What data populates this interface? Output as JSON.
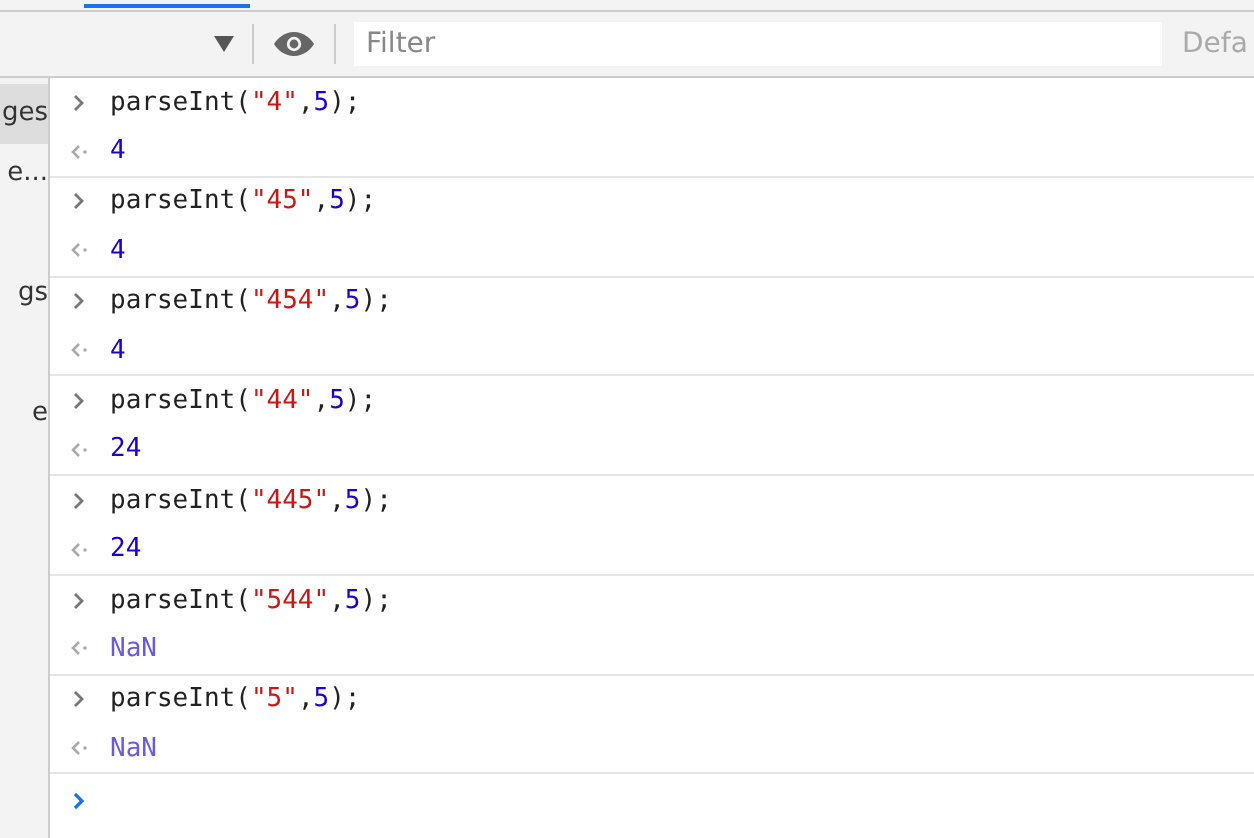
{
  "toolbar": {
    "filter": {
      "placeholder": "Filter"
    },
    "levels_label": "Defa"
  },
  "sidebar": {
    "items": [
      {
        "label": "ges",
        "selected": true
      },
      {
        "label": "e...",
        "selected": false
      },
      {
        "label": "gs",
        "selected": false
      },
      {
        "label": "e",
        "selected": false
      }
    ]
  },
  "console": {
    "entries": [
      {
        "input": [
          {
            "kind": "plain",
            "text": "parseInt("
          },
          {
            "kind": "string",
            "text": "\"4\""
          },
          {
            "kind": "plain",
            "text": ","
          },
          {
            "kind": "number",
            "text": "5"
          },
          {
            "kind": "plain",
            "text": ");"
          }
        ],
        "result": {
          "kind": "number",
          "text": "4"
        }
      },
      {
        "input": [
          {
            "kind": "plain",
            "text": "parseInt("
          },
          {
            "kind": "string",
            "text": "\"45\""
          },
          {
            "kind": "plain",
            "text": ","
          },
          {
            "kind": "number",
            "text": "5"
          },
          {
            "kind": "plain",
            "text": ");"
          }
        ],
        "result": {
          "kind": "number",
          "text": "4"
        }
      },
      {
        "input": [
          {
            "kind": "plain",
            "text": "parseInt("
          },
          {
            "kind": "string",
            "text": "\"454\""
          },
          {
            "kind": "plain",
            "text": ","
          },
          {
            "kind": "number",
            "text": "5"
          },
          {
            "kind": "plain",
            "text": ");"
          }
        ],
        "result": {
          "kind": "number",
          "text": "4"
        }
      },
      {
        "input": [
          {
            "kind": "plain",
            "text": "parseInt("
          },
          {
            "kind": "string",
            "text": "\"44\""
          },
          {
            "kind": "plain",
            "text": ","
          },
          {
            "kind": "number",
            "text": "5"
          },
          {
            "kind": "plain",
            "text": ");"
          }
        ],
        "result": {
          "kind": "number",
          "text": "24"
        }
      },
      {
        "input": [
          {
            "kind": "plain",
            "text": "parseInt("
          },
          {
            "kind": "string",
            "text": "\"445\""
          },
          {
            "kind": "plain",
            "text": ","
          },
          {
            "kind": "number",
            "text": "5"
          },
          {
            "kind": "plain",
            "text": ");"
          }
        ],
        "result": {
          "kind": "number",
          "text": "24"
        }
      },
      {
        "input": [
          {
            "kind": "plain",
            "text": "parseInt("
          },
          {
            "kind": "string",
            "text": "\"544\""
          },
          {
            "kind": "plain",
            "text": ","
          },
          {
            "kind": "number",
            "text": "5"
          },
          {
            "kind": "plain",
            "text": ");"
          }
        ],
        "result": {
          "kind": "nan",
          "text": "NaN"
        }
      },
      {
        "input": [
          {
            "kind": "plain",
            "text": "parseInt("
          },
          {
            "kind": "string",
            "text": "\"5\""
          },
          {
            "kind": "plain",
            "text": ","
          },
          {
            "kind": "number",
            "text": "5"
          },
          {
            "kind": "plain",
            "text": ");"
          }
        ],
        "result": {
          "kind": "nan",
          "text": "NaN"
        }
      }
    ]
  }
}
